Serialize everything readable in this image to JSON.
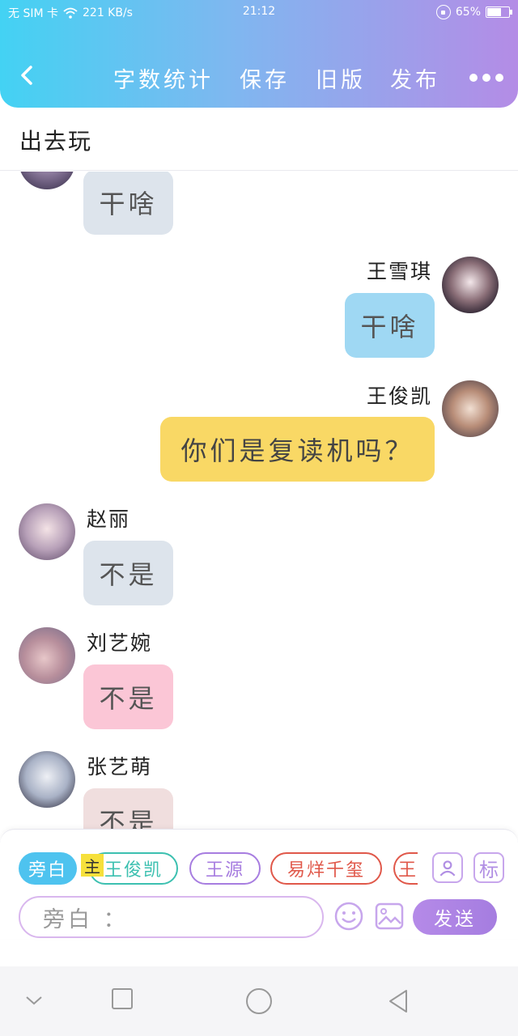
{
  "status_bar": {
    "carrier": "无 SIM 卡",
    "speed": "221 KB/s",
    "time": "21:12",
    "battery": "65%",
    "battery_level": 0.65
  },
  "toolbar": {
    "word_count": "字数统计",
    "save": "保存",
    "old_version": "旧版",
    "publish": "发布"
  },
  "title": "出去玩",
  "messages": [
    {
      "side": "left",
      "name": "",
      "text": "干啥",
      "bubble_color": "#dde4ec"
    },
    {
      "side": "right",
      "name": "王雪琪",
      "text": "干啥",
      "bubble_color": "#9fd8f3"
    },
    {
      "side": "right",
      "name": "王俊凯",
      "text": "你们是复读机吗？",
      "bubble_color": "#f9d865"
    },
    {
      "side": "left",
      "name": "赵丽",
      "text": "不是",
      "bubble_color": "#dde4ec"
    },
    {
      "side": "left",
      "name": "刘艺婉",
      "text": "不是",
      "bubble_color": "#fbc6d6"
    },
    {
      "side": "left",
      "name": "张艺萌",
      "text": "不是",
      "bubble_color": "#f0dede"
    }
  ],
  "composer": {
    "chips": [
      {
        "label": "旁白",
        "color": "#4ec3ef"
      },
      {
        "label": "王俊凯",
        "color": "#3cc0b0"
      },
      {
        "label": "王源",
        "color": "#a77de0"
      },
      {
        "label": "易烊千玺",
        "color": "#e0584a"
      },
      {
        "label": "王",
        "color": "#e0584a"
      }
    ],
    "main_tag": "主",
    "tag_icon_label": "标",
    "input_placeholder": "旁白 ：",
    "send": "发送"
  },
  "colors": {
    "accent_purple": "#a57de0",
    "header_start": "#43d2f3",
    "header_end": "#b48ce6"
  }
}
